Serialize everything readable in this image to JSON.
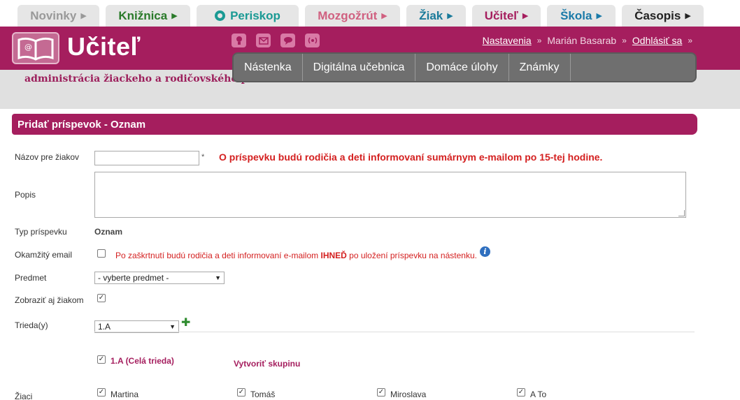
{
  "top_tabs": [
    {
      "label": "Novinky",
      "color": "#999999"
    },
    {
      "label": "Knižnica",
      "color": "#2a7a2a"
    },
    {
      "label": "Periskop",
      "color": "#1a9a94"
    },
    {
      "label": "Mozgožrút",
      "color": "#d06080"
    },
    {
      "label": "Žiak",
      "color": "#1a7a9a"
    },
    {
      "label": "Učiteľ",
      "color": "#a51e5e"
    },
    {
      "label": "Škola",
      "color": "#1a7aa8"
    },
    {
      "label": "Časopis",
      "color": "#222222"
    }
  ],
  "tab_arrow": "▶",
  "header": {
    "logo_text": "Učiteľ",
    "tagline": "administrácia žiackeho a rodičovského portálu",
    "icons": [
      "lightbulb-icon",
      "mail-icon",
      "chat-icon",
      "radio-icon"
    ],
    "settings_link": "Nastavenia",
    "user_name": "Marián Basarab",
    "logout_link": "Odhlásiť sa",
    "sep": "»"
  },
  "main_nav": [
    "Nástenka",
    "Digitálna učebnica",
    "Domáce úlohy",
    "Známky"
  ],
  "panel_title": "Pridať príspevok - Oznam",
  "form": {
    "title_label": "Názov pre žiakov",
    "title_value": "",
    "required_mark": "*",
    "summary_note": "O príspevku budú rodičia a deti informovaní sumárnym e-mailom po 15-tej hodine.",
    "description_label": "Popis",
    "type_label": "Typ príspevku",
    "type_value": "Oznam",
    "instant_email_label": "Okamžitý email",
    "instant_email_checked": false,
    "instant_note_before": "Po zaškrtnutí budú rodičia a deti informovaní e-mailom ",
    "instant_note_strong": "IHNEĎ",
    "instant_note_after": " po uložení príspevku na nástenku.",
    "subject_label": "Predmet",
    "subject_value": "- vyberte predmet -",
    "show_students_label": "Zobraziť aj žiakom",
    "show_students_checked": true,
    "class_label": "Trieda(y)",
    "class_value": "1.A",
    "class_item": "1.A (Celá trieda)",
    "create_group": "Vytvoriť skupinu",
    "students_label": "Žiaci",
    "students": [
      "Martina",
      "Tomáš",
      "Miroslava",
      "A To"
    ]
  },
  "colors": {
    "brand": "#a51e5e",
    "nav": "#6f6f6f",
    "alert": "#d42020"
  }
}
